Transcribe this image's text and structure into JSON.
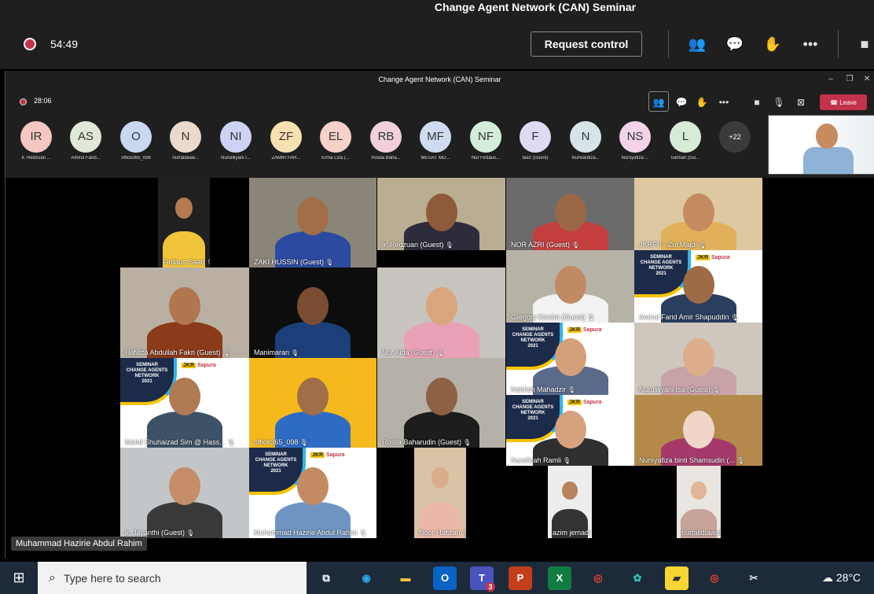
{
  "outer": {
    "title": "Change Agent Network (CAN) Seminar",
    "timer": "54:49",
    "request_control": "Request control"
  },
  "inner": {
    "title": "Change Agent Network (CAN) Seminar",
    "timer": "28:06",
    "leave": "Leave",
    "more_count": "+22",
    "win_min": "–",
    "win_max": "❐",
    "win_close": "✕"
  },
  "roster": [
    {
      "initials": "IR",
      "name": "Ir. Redzuan ...",
      "color": "#f4c7c3"
    },
    {
      "initials": "AS",
      "name": "Amirul Farid...",
      "color": "#dfe8d6"
    },
    {
      "initials": "O",
      "name": "office365_098",
      "color": "#c9d8ef"
    },
    {
      "initials": "N",
      "name": "nurfalidiaw...",
      "color": "#ead9cd"
    },
    {
      "initials": "NI",
      "name": "Nuruliliyani I...",
      "color": "#cfd3f3"
    },
    {
      "initials": "ZF",
      "name": "ZAMIR FAR...",
      "color": "#f6e1b3"
    },
    {
      "initials": "EL",
      "name": "Erma Liza (...",
      "color": "#f5d1c7"
    },
    {
      "initials": "RB",
      "name": "Rosila Baha...",
      "color": "#f1cfdb"
    },
    {
      "initials": "MF",
      "name": "MEGAT MO...",
      "color": "#cfdcef"
    },
    {
      "initials": "NF",
      "name": "Nur Firdaus...",
      "color": "#d3edd9"
    },
    {
      "initials": "F",
      "name": "faez (Guest)",
      "color": "#dedcf2"
    },
    {
      "initials": "N",
      "name": "Nurwardiza...",
      "color": "#d6e4e8"
    },
    {
      "initials": "NS",
      "name": "Nursyafiza ...",
      "color": "#f3d3e7"
    },
    {
      "initials": "L",
      "name": "lukman (Gu...",
      "color": "#d7ecd6"
    }
  ],
  "tiles": [
    {
      "label": "Firdaus Saad",
      "bg": "#202020"
    },
    {
      "label": "ZAKI HUSSIN (Guest)",
      "bg": "#8a8578"
    },
    {
      "label": "Ir. Redzuan (Guest)",
      "bg": "#b9ad92"
    },
    {
      "label": "NOR AZRI (Guest)",
      "bg": "#6b6b6b"
    },
    {
      "label": "JKRPP - Zul Majdi",
      "bg": "#ddc8a2"
    },
    {
      "label": "Hafiliza Abdullah Fakri (Guest)",
      "bg": "#b9b0a3"
    },
    {
      "label": "Manimaran",
      "bg": "#0d0d0d"
    },
    {
      "label": "Nur Aida (Guest)",
      "bg": "#c7c4bf"
    },
    {
      "label": "Gregory Kinsim (Guest)",
      "bg": "#b7b2a6"
    },
    {
      "label": "Amirul Farid Amir Shapuddin",
      "bg": "#ffffff"
    },
    {
      "label": "Mohd Shuhaizad Sim @ Hass...",
      "bg": "#ffffff"
    },
    {
      "label": "office365_098",
      "bg": "#f5b91e"
    },
    {
      "label": "Rosila Baharudin (Guest)",
      "bg": "#b6b1a8"
    },
    {
      "label": "Nabilah Mahadzir",
      "bg": "#ffffff"
    },
    {
      "label": "Nuruliliyani Isa (Guest)",
      "bg": "#cfc6bd"
    },
    {
      "label": "Nurafizah Ramli",
      "bg": "#ffffff"
    },
    {
      "label": "Nursyafiza binti Shamsudin (...",
      "bg": "#b48a4c"
    },
    {
      "label": "Ir. Jayanthi (Guest)",
      "bg": "#c3c6c8"
    },
    {
      "label": "Muhammad Hazirie Abdul Rahim",
      "bg": "#ffffff"
    },
    {
      "label": "Noor Hafizan",
      "bg": "#d8c3a5"
    },
    {
      "label": "azim jemadi",
      "bg": "#ededed"
    },
    {
      "label": "nurfalidiawati",
      "bg": "#e9e5e0"
    }
  ],
  "banner": {
    "l1": "SEMINAR",
    "l2": "CHANGE AGENTS",
    "l3": "NETWORK",
    "l4": "2021",
    "brand1": "JKR",
    "brand2": "Sapura"
  },
  "self_name": "Muhammad Hazirie Abdul Rahim",
  "taskbar": {
    "search_placeholder": "Type here to search",
    "teams_badge": "3",
    "temperature": "28°C"
  }
}
